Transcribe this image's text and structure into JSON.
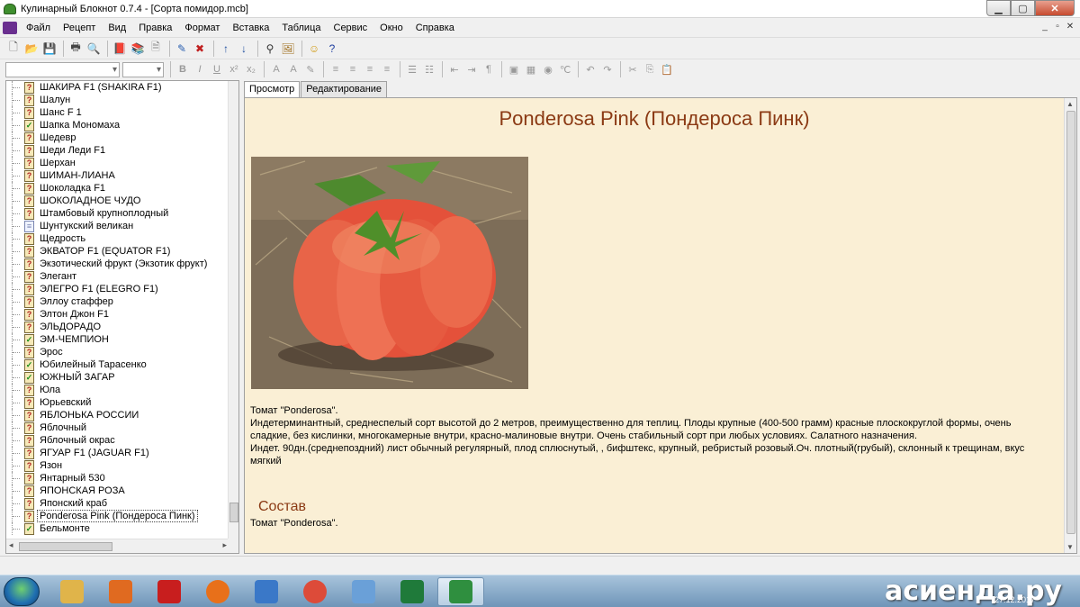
{
  "window": {
    "title": "Кулинарный Блокнот 0.7.4 - [Сорта помидор.mcb]",
    "minimize": "▁",
    "maximize": "▢",
    "close": "✕"
  },
  "menubar": {
    "items": [
      "Файл",
      "Рецепт",
      "Вид",
      "Правка",
      "Формат",
      "Вставка",
      "Таблица",
      "Сервис",
      "Окно",
      "Справка"
    ],
    "right_controls": [
      "_",
      "▫",
      "✕"
    ]
  },
  "toolbar1": {
    "icons": [
      "new-file-icon",
      "open-folder-icon",
      "save-icon",
      "print-icon",
      "print-preview-icon",
      "book-icon",
      "books-icon",
      "page-icon",
      "edit-icon",
      "delete-icon",
      "arrow-up-icon",
      "arrow-down-icon",
      "binoculars-icon",
      "picture-icon",
      "smiley-icon",
      "help-icon"
    ],
    "glyphs": [
      "🗋",
      "📂",
      "💾",
      "🖶",
      "🔍",
      "📕",
      "📚",
      "🗎",
      "✎",
      "✖",
      "↑",
      "↓",
      "⚲",
      "🖼",
      "☺",
      "?"
    ]
  },
  "toolbar2": {
    "font_name": "",
    "font_size": "",
    "icons": [
      "bold-icon",
      "italic-icon",
      "underline-icon",
      "superscript-icon",
      "subscript-icon",
      "font-size-icon",
      "font-color-icon",
      "highlight-icon",
      "align-left-icon",
      "align-center-icon",
      "align-right-icon",
      "justify-icon",
      "bullets-icon",
      "numbering-icon",
      "outdent-icon",
      "indent-icon",
      "paragraph-icon",
      "insert-image-icon",
      "insert-table-icon",
      "insert-object-icon",
      "insert-special-icon",
      "undo-icon",
      "redo-icon",
      "cut-icon",
      "copy-icon",
      "paste-icon"
    ],
    "glyphs": [
      "B",
      "I",
      "U",
      "x²",
      "x₂",
      "A",
      "A",
      "✎",
      "≡",
      "≡",
      "≡",
      "≡",
      "☰",
      "☷",
      "⇤",
      "⇥",
      "¶",
      "▣",
      "▦",
      "◉",
      "℃",
      "↶",
      "↷",
      "✂",
      "⎘",
      "📋"
    ]
  },
  "tree": {
    "items": [
      {
        "label": "ШАКИРА F1 (SHAKIRA F1)",
        "status": "q"
      },
      {
        "label": "Шалун",
        "status": "q"
      },
      {
        "label": "Шанс F 1",
        "status": "q"
      },
      {
        "label": "Шапка Мономаха",
        "status": "ok"
      },
      {
        "label": "Шедевр",
        "status": "q"
      },
      {
        "label": "Шеди Леди F1",
        "status": "q"
      },
      {
        "label": "Шерхан",
        "status": "q"
      },
      {
        "label": "ШИМАН-ЛИАНА",
        "status": "q"
      },
      {
        "label": "Шоколадка F1",
        "status": "q"
      },
      {
        "label": "ШОКОЛАДНОЕ ЧУДО",
        "status": "q"
      },
      {
        "label": "Штамбовый крупноплодный",
        "status": "q"
      },
      {
        "label": "Шунтукский великан",
        "status": "plain"
      },
      {
        "label": "Щедрость",
        "status": "q"
      },
      {
        "label": "ЭКВАТОР F1 (EQUATOR F1)",
        "status": "q"
      },
      {
        "label": "Экзотический фрукт (Экзотик фрукт)",
        "status": "q"
      },
      {
        "label": "Элегант",
        "status": "q"
      },
      {
        "label": "ЭЛЕГРО F1 (ELEGRO F1)",
        "status": "q"
      },
      {
        "label": "Эллоу стаффер",
        "status": "q"
      },
      {
        "label": "Элтон Джон F1",
        "status": "q"
      },
      {
        "label": "ЭЛЬДОРАДО",
        "status": "q"
      },
      {
        "label": "ЭМ-ЧЕМПИОН",
        "status": "ok"
      },
      {
        "label": "Эрос",
        "status": "q"
      },
      {
        "label": "Юбилейный Тарасенко",
        "status": "ok"
      },
      {
        "label": "ЮЖНЫЙ ЗАГАР",
        "status": "ok"
      },
      {
        "label": "Юла",
        "status": "q"
      },
      {
        "label": "Юрьевский",
        "status": "q"
      },
      {
        "label": "ЯБЛОНЬКА РОССИИ",
        "status": "q"
      },
      {
        "label": "Яблочный",
        "status": "q"
      },
      {
        "label": "Яблочный окрас",
        "status": "q"
      },
      {
        "label": "ЯГУАР F1 (JAGUAR F1)",
        "status": "q"
      },
      {
        "label": "Язон",
        "status": "q"
      },
      {
        "label": "Янтарный 530",
        "status": "q"
      },
      {
        "label": "ЯПОНСКАЯ РОЗА",
        "status": "q"
      },
      {
        "label": "Японский краб",
        "status": "q"
      },
      {
        "label": "Ponderosa Pink (Пондероса Пинк)",
        "status": "q",
        "selected": true
      },
      {
        "label": "Бельмонте",
        "status": "ok"
      }
    ],
    "status_glyphs": {
      "q": "?",
      "ok": "✓",
      "plain": "≡"
    }
  },
  "tabs": [
    {
      "label": "Просмотр",
      "active": true
    },
    {
      "label": "Редактирование",
      "active": false
    }
  ],
  "content": {
    "title": "Ponderosa Pink (Пондероса Пинк)",
    "description_lines": [
      "Томат \"Ponderosa\".",
      "Индетерминантный, среднеспелый сорт высотой до 2 метров, преимущественно для теплиц. Плоды крупные (400-500 грамм) красные плоскокруглой формы, очень сладкие, без кислинки, многокамерные внутри, красно-малиновые внутри. Очень стабильный сорт при любых условиях. Салатного назначения.",
      "Индет. 90дн.(среднепоздний) лист обычный регулярный, плод сплюснутый, , бифштекс, крупный, ребристый розовый.Оч. плотный(грубый), склонный к трещинам, вкус мягкий"
    ],
    "section_title": "Состав",
    "section_text": "Томат \"Ponderosa\"."
  },
  "taskbar": {
    "apps": [
      "explorer-icon",
      "media-player-icon",
      "kaspersky-icon",
      "firefox-icon",
      "speaker-icon",
      "chrome-icon",
      "paint-icon",
      "excel-icon",
      "culinary-notebook-icon"
    ],
    "watermark": "асиенда.ру",
    "date": "27.12.2017"
  },
  "colors": {
    "content_bg": "#faefd5",
    "heading": "#8b3a14"
  }
}
